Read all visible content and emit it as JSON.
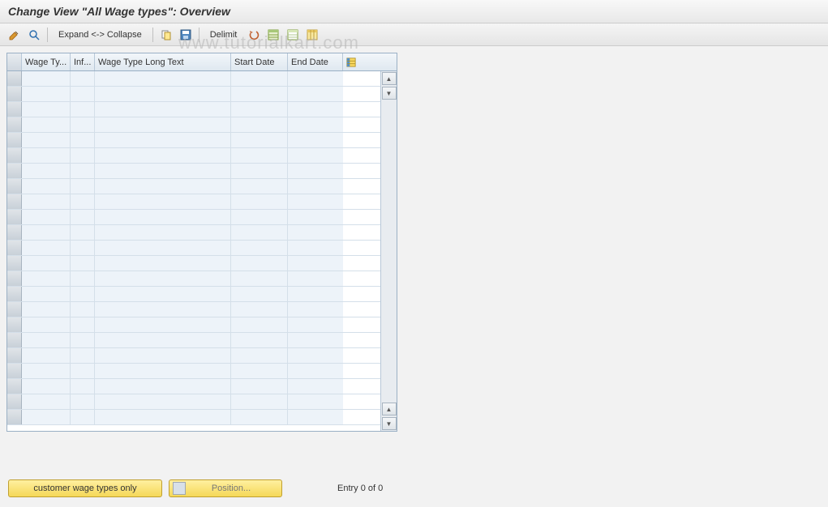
{
  "title": "Change View \"All Wage types\": Overview",
  "toolbar": {
    "expand_collapse": "Expand <-> Collapse",
    "delimit": "Delimit"
  },
  "table": {
    "columns": {
      "wage_type": "Wage Ty...",
      "inf": "Inf...",
      "long_text": "Wage Type Long Text",
      "start_date": "Start Date",
      "end_date": "End Date"
    },
    "rows": [
      {
        "wage_type": "",
        "inf": "",
        "long_text": "",
        "start_date": "",
        "end_date": ""
      },
      {
        "wage_type": "",
        "inf": "",
        "long_text": "",
        "start_date": "",
        "end_date": ""
      },
      {
        "wage_type": "",
        "inf": "",
        "long_text": "",
        "start_date": "",
        "end_date": ""
      },
      {
        "wage_type": "",
        "inf": "",
        "long_text": "",
        "start_date": "",
        "end_date": ""
      },
      {
        "wage_type": "",
        "inf": "",
        "long_text": "",
        "start_date": "",
        "end_date": ""
      },
      {
        "wage_type": "",
        "inf": "",
        "long_text": "",
        "start_date": "",
        "end_date": ""
      },
      {
        "wage_type": "",
        "inf": "",
        "long_text": "",
        "start_date": "",
        "end_date": ""
      },
      {
        "wage_type": "",
        "inf": "",
        "long_text": "",
        "start_date": "",
        "end_date": ""
      },
      {
        "wage_type": "",
        "inf": "",
        "long_text": "",
        "start_date": "",
        "end_date": ""
      },
      {
        "wage_type": "",
        "inf": "",
        "long_text": "",
        "start_date": "",
        "end_date": ""
      },
      {
        "wage_type": "",
        "inf": "",
        "long_text": "",
        "start_date": "",
        "end_date": ""
      },
      {
        "wage_type": "",
        "inf": "",
        "long_text": "",
        "start_date": "",
        "end_date": ""
      },
      {
        "wage_type": "",
        "inf": "",
        "long_text": "",
        "start_date": "",
        "end_date": ""
      },
      {
        "wage_type": "",
        "inf": "",
        "long_text": "",
        "start_date": "",
        "end_date": ""
      },
      {
        "wage_type": "",
        "inf": "",
        "long_text": "",
        "start_date": "",
        "end_date": ""
      },
      {
        "wage_type": "",
        "inf": "",
        "long_text": "",
        "start_date": "",
        "end_date": ""
      },
      {
        "wage_type": "",
        "inf": "",
        "long_text": "",
        "start_date": "",
        "end_date": ""
      },
      {
        "wage_type": "",
        "inf": "",
        "long_text": "",
        "start_date": "",
        "end_date": ""
      },
      {
        "wage_type": "",
        "inf": "",
        "long_text": "",
        "start_date": "",
        "end_date": ""
      },
      {
        "wage_type": "",
        "inf": "",
        "long_text": "",
        "start_date": "",
        "end_date": ""
      },
      {
        "wage_type": "",
        "inf": "",
        "long_text": "",
        "start_date": "",
        "end_date": ""
      },
      {
        "wage_type": "",
        "inf": "",
        "long_text": "",
        "start_date": "",
        "end_date": ""
      },
      {
        "wage_type": "",
        "inf": "",
        "long_text": "",
        "start_date": "",
        "end_date": ""
      }
    ]
  },
  "footer": {
    "customer_btn": "customer wage types only",
    "position_btn": "Position...",
    "entry_text": "Entry 0 of 0"
  },
  "watermark": "www.tutorialkart.com"
}
